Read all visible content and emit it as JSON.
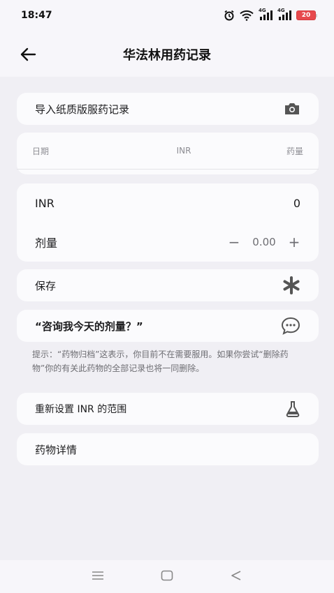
{
  "status_bar": {
    "time": "18:47",
    "battery": "20",
    "signal_a": "4G",
    "signal_b": "4G"
  },
  "app_bar": {
    "title": "华法林用药记录"
  },
  "import_card": {
    "label": "导入纸质版服药记录",
    "icon": "camera-icon"
  },
  "table_header": {
    "date": "日期",
    "inr": "INR",
    "dose": "药量"
  },
  "entry": {
    "inr_label": "INR",
    "inr_value": "0",
    "dose_label": "剂量",
    "dose_minus": "−",
    "dose_value": "0.00",
    "dose_plus": "+"
  },
  "save_card": {
    "label": "保存",
    "icon": "asterisk-icon"
  },
  "ask_card": {
    "label": "“咨询我今天的剂量？”",
    "icon": "chat-bubble-icon"
  },
  "hint": "提示：“药物归档”这表示，你目前不在需要服用。如果你尝试“删除药物”你的有关此药物的全部记录也将一同删除。",
  "reset_card": {
    "label": "重新设置 INR 的范围",
    "icon": "flask-icon"
  },
  "details_card": {
    "label": "药物详情"
  },
  "colors": {
    "background": "#f0eff4",
    "card": "#fbfbfd",
    "battery": "#e7494d"
  }
}
